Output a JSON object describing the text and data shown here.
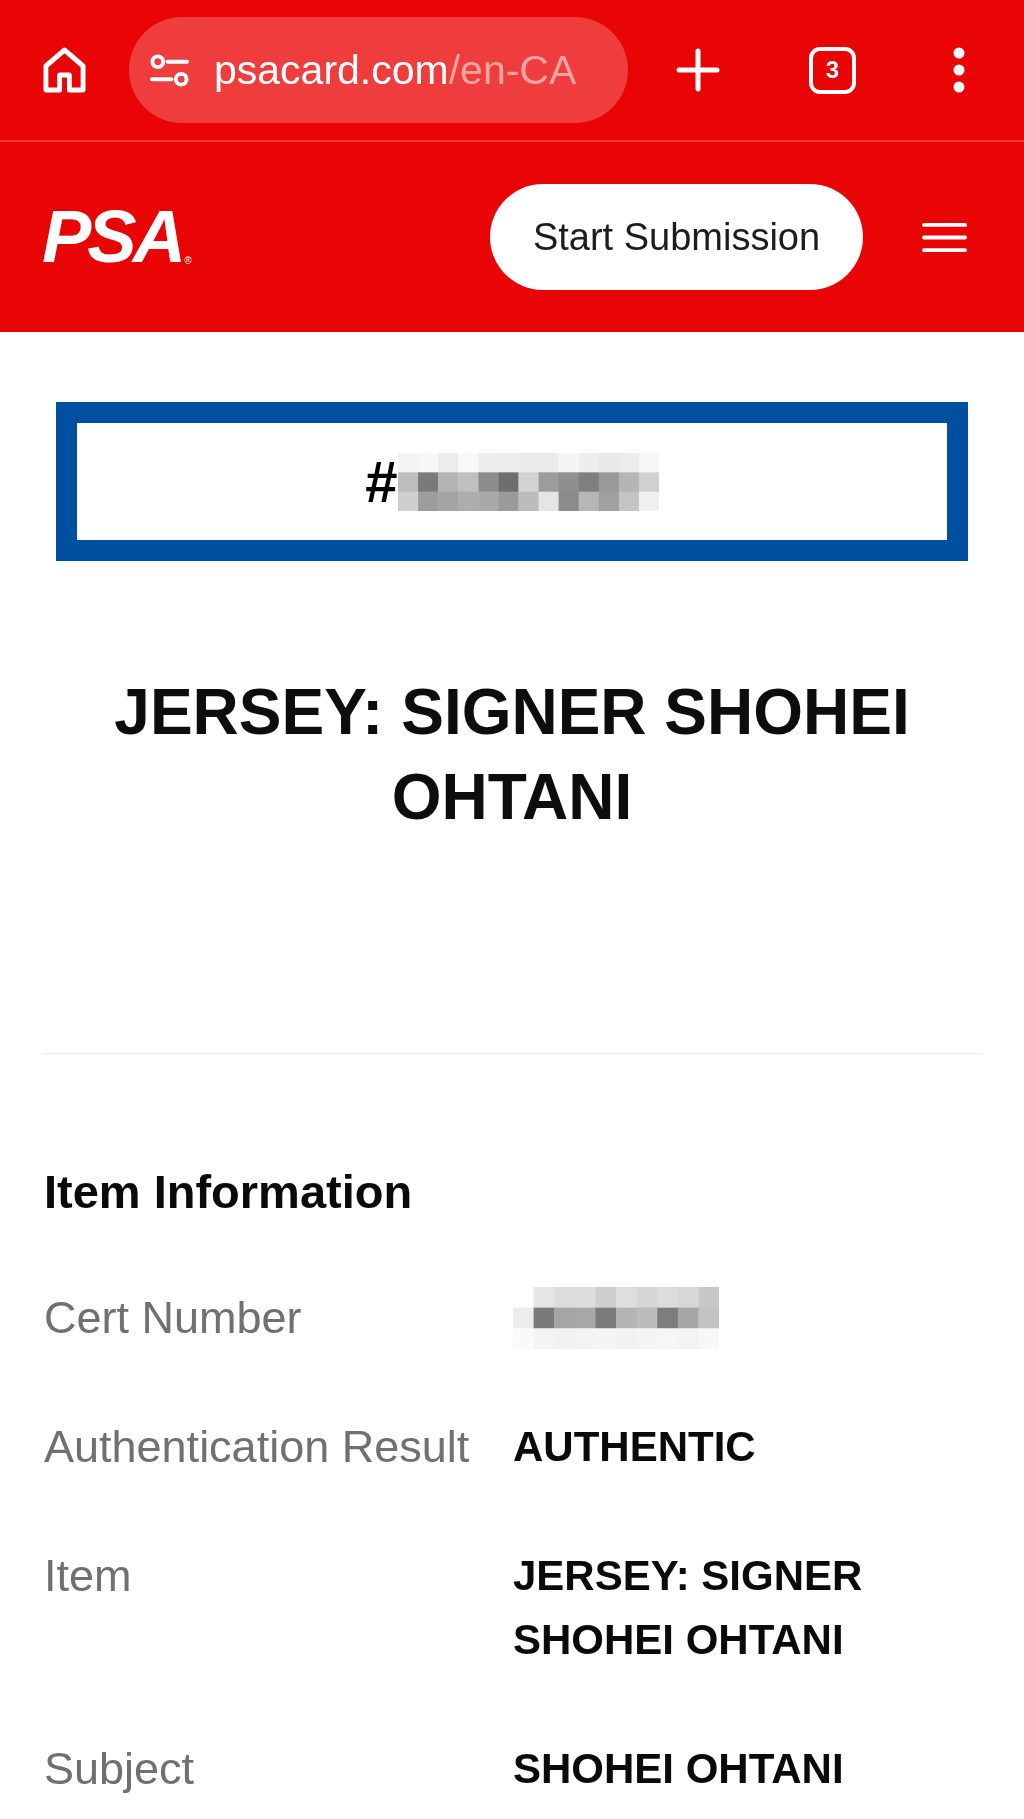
{
  "browser": {
    "url": {
      "host": "psacard.com",
      "path": "/en-CA"
    },
    "tab_count": "3"
  },
  "site_header": {
    "logo": {
      "text": "PSA",
      "mark": "®"
    },
    "cta": "Start Submission"
  },
  "cert_banner": {
    "prefix": "#",
    "redacted": true
  },
  "title": "JERSEY: SIGNER SHOHEI OHTANI",
  "item_information": {
    "heading": "Item Information",
    "rows": [
      {
        "kind": "redacted",
        "label": "Cert Number"
      },
      {
        "kind": "text",
        "label": "Authentication Result",
        "value": "AUTHENTIC"
      },
      {
        "kind": "text",
        "label": "Item",
        "value": "JERSEY: SIGNER SHOHEI OHTANI"
      },
      {
        "kind": "text",
        "label": "Subject",
        "value": "SHOHEI OHTANI"
      }
    ]
  }
}
